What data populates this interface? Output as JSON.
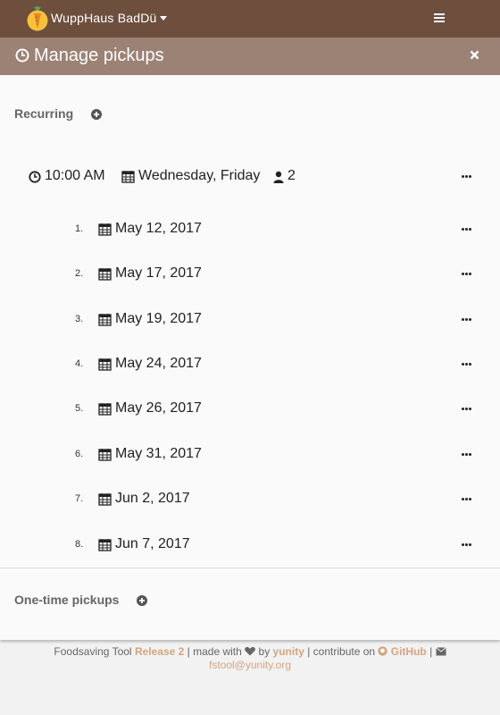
{
  "topbar": {
    "group_name": "WuppHaus BadDü",
    "logo_icon": "carrot-logo",
    "menu_icon": "hamburger-icon"
  },
  "titlebar": {
    "title": "Manage pickups",
    "title_icon": "clock-icon",
    "close_icon": "close-icon"
  },
  "recurring": {
    "label": "Recurring",
    "add_icon": "plus-circle-icon"
  },
  "series": {
    "time": "10:00 AM",
    "days": "Wednesday, Friday",
    "max_collectors": "2"
  },
  "pickups": [
    {
      "num": "1.",
      "date": "May 12, 2017"
    },
    {
      "num": "2.",
      "date": "May 17, 2017"
    },
    {
      "num": "3.",
      "date": "May 19, 2017"
    },
    {
      "num": "4.",
      "date": "May 24, 2017"
    },
    {
      "num": "5.",
      "date": "May 26, 2017"
    },
    {
      "num": "6.",
      "date": "May 31, 2017"
    },
    {
      "num": "7.",
      "date": "Jun 2, 2017"
    },
    {
      "num": "8.",
      "date": "Jun 7, 2017"
    }
  ],
  "one_time": {
    "label": "One-time pickups",
    "add_icon": "plus-circle-icon"
  },
  "footer": {
    "app_name": "Foodsaving Tool",
    "release": "Release 2",
    "made_with": "| made with",
    "by": "by",
    "org": "yunity",
    "contribute": "| contribute on",
    "github": "GitHub",
    "sep": "|",
    "email": "fstool@yunity.org"
  },
  "colors": {
    "topbar": "#6e4f3e",
    "titlebar": "#9c8275",
    "link": "#d4a580"
  }
}
